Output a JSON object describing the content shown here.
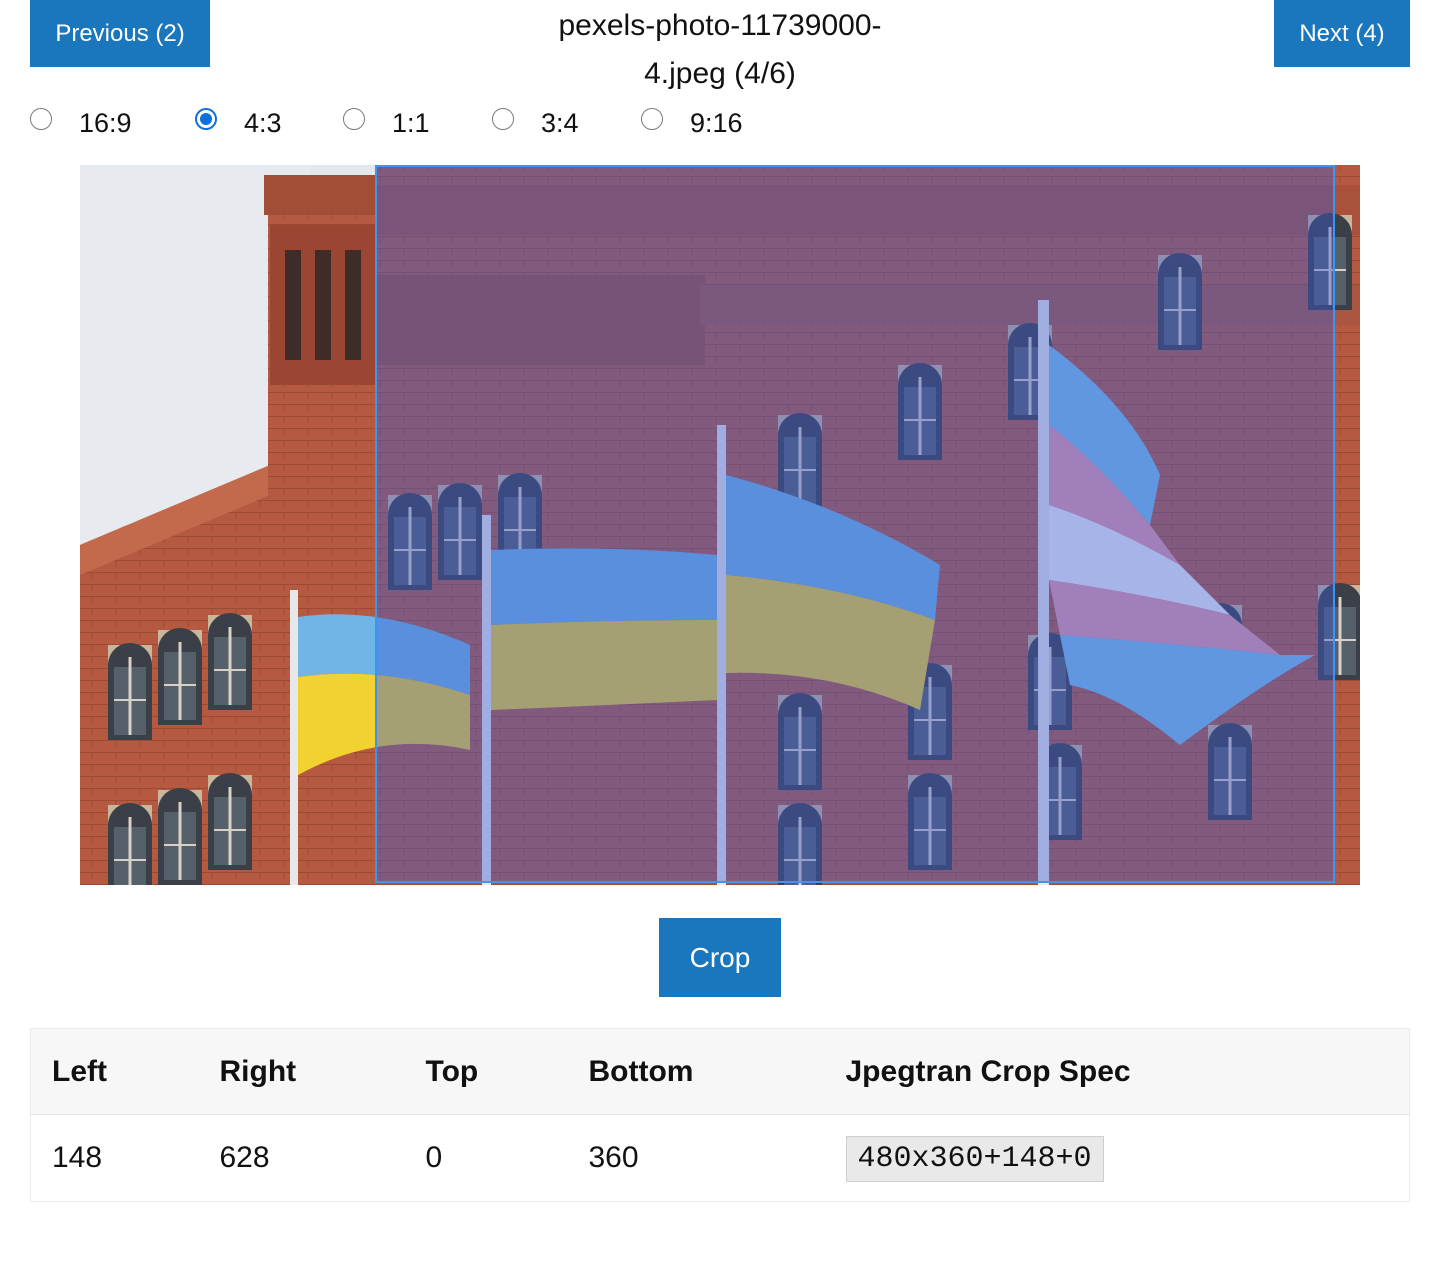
{
  "navigation": {
    "previous_label": "Previous (2)",
    "next_label": "Next (4)",
    "file_title": "pexels-photo-11739000-4.jpeg (4/6)"
  },
  "aspect_ratios": {
    "options": [
      "16:9",
      "4:3",
      "1:1",
      "3:4",
      "9:16"
    ],
    "selected": "4:3"
  },
  "crop_button_label": "Crop",
  "coordinates_table": {
    "headers": [
      "Left",
      "Right",
      "Top",
      "Bottom",
      "Jpegtran Crop Spec"
    ],
    "row": {
      "left": "148",
      "right": "628",
      "top": "0",
      "bottom": "360",
      "spec": "480x360+148+0"
    }
  },
  "colors": {
    "accent": "#1a76bd",
    "radio_selected": "#0b6fe0",
    "crop_border": "#3d95ef",
    "crop_overlay": "rgba(60,90,210,0.42)"
  },
  "icons": {
    "radio_selected": "radio-checked-icon",
    "radio_unselected": "radio-unchecked-icon"
  }
}
